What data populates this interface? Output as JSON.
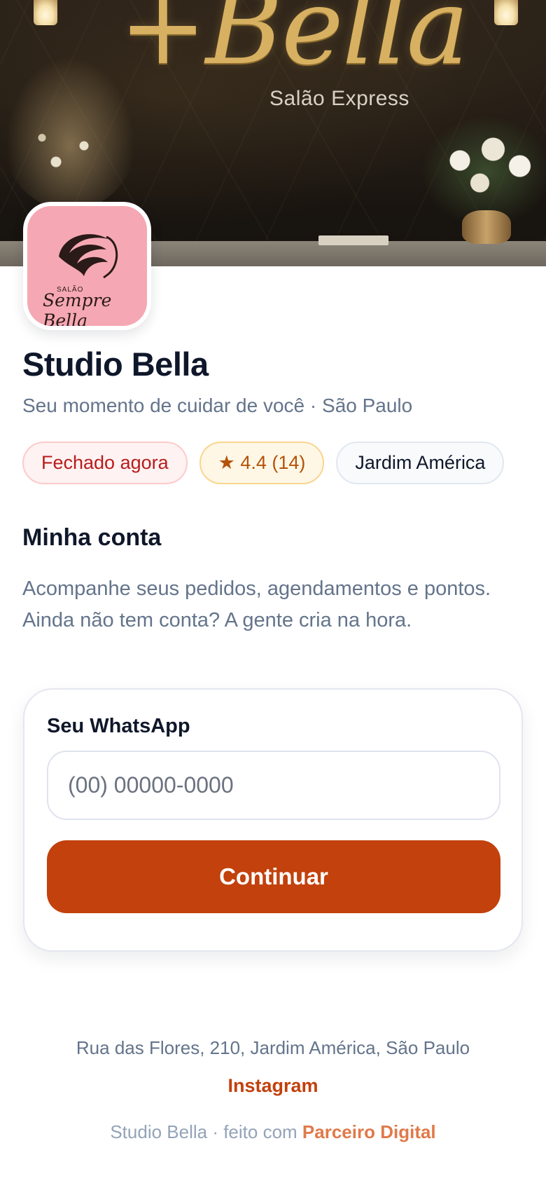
{
  "hero": {
    "brand_script": "+Bella",
    "brand_sub": "Salão Express"
  },
  "logo": {
    "small": "SALÃO",
    "script": "Sempre Bella",
    "background": "#f5a8b3"
  },
  "business": {
    "name": "Studio Bella",
    "tagline": "Seu momento de cuidar de você · São Paulo"
  },
  "chips": {
    "status": "Fechado agora",
    "rating": "★ 4.4 (14)",
    "neighborhood": "Jardim América"
  },
  "account": {
    "title": "Minha conta",
    "description": "Acompanhe seus pedidos, agendamentos e pontos. Ainda não tem conta? A gente cria na hora.",
    "whatsapp_label": "Seu WhatsApp",
    "whatsapp_value": "",
    "whatsapp_placeholder": "(00) 00000-0000",
    "continue_label": "Continuar"
  },
  "footer": {
    "address": "Rua das Flores, 210, Jardim América, São Paulo",
    "instagram": "Instagram",
    "credit_prefix": "Studio Bella · feito com ",
    "credit_link": "Parceiro Digital"
  },
  "colors": {
    "accent": "#c2410c",
    "closed": "#b91c1c",
    "rating": "#b45309"
  }
}
